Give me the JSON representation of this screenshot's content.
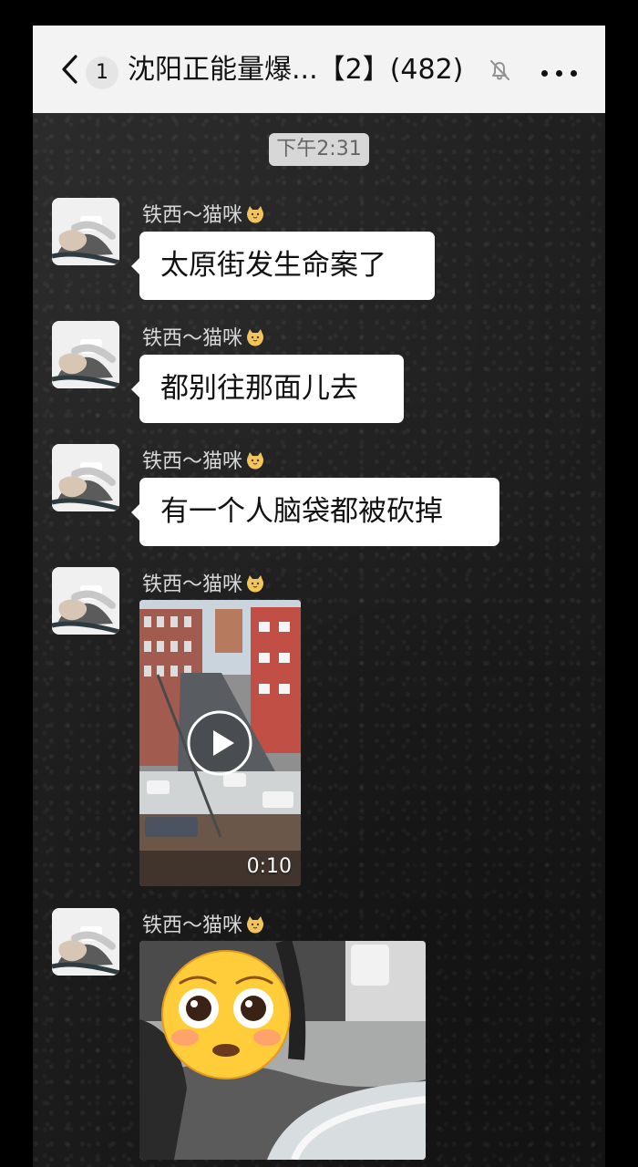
{
  "header": {
    "back_icon": "chevron-left-icon",
    "unread_badge": "1",
    "title": "沈阳正能量爆...【2】(482)",
    "mute_icon": "bell-off-icon",
    "more_icon": "more-horizontal-icon"
  },
  "timestamp": "下午2:31",
  "messages": [
    {
      "type": "text",
      "sender": "铁西～猫咪",
      "text": "太原街发生命案了"
    },
    {
      "type": "text",
      "sender": "铁西～猫咪",
      "text": "都别往那面儿去"
    },
    {
      "type": "text",
      "sender": "铁西～猫咪",
      "text": "有一个人脑袋都被砍掉"
    },
    {
      "type": "video",
      "sender": "铁西～猫咪",
      "duration": "0:10"
    },
    {
      "type": "image",
      "sender": "铁西～猫咪"
    }
  ],
  "theme": {
    "header_bg": "#f3f3f3",
    "chat_bg": "#202020",
    "bubble_bg": "#ffffff",
    "accent_badge": "#e5e5e5"
  }
}
